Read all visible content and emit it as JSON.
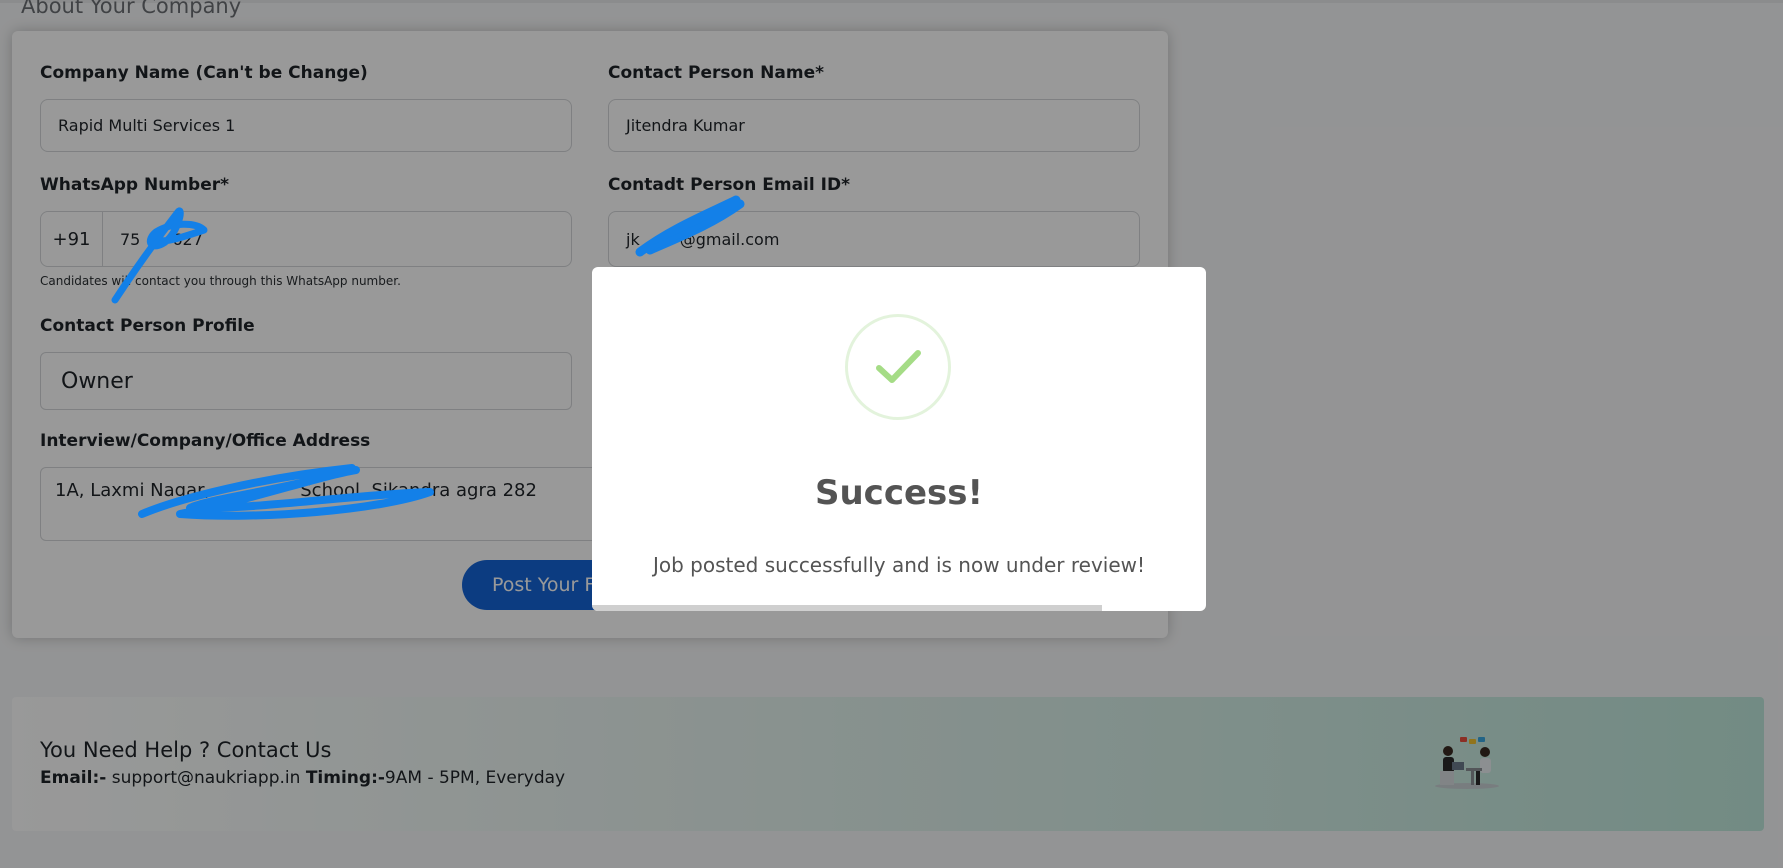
{
  "section": {
    "heading": "About Your Company"
  },
  "form": {
    "company_name": {
      "label": "Company Name (Can't be Change)",
      "value": "Rapid Multi Services 1"
    },
    "contact_person_name": {
      "label": "Contact Person Name*",
      "value": "Jitendra Kumar"
    },
    "whatsapp": {
      "label": "WhatsApp Number*",
      "prefix": "+91",
      "value": "75    627",
      "hint": "Candidates will contact you through this WhatsApp number."
    },
    "contact_email": {
      "label": "Contadt Person Email ID*",
      "value": "jk     @gmail.com"
    },
    "contact_profile": {
      "label": "Contact Person Profile",
      "value": "Owner"
    },
    "address": {
      "label": "Interview/Company/Office Address",
      "value": "1A, Laxmi Nagar,          School, Sikandra agra 282"
    },
    "submit_label": "Post Your F"
  },
  "help": {
    "title": "You Need Help ? Contact Us",
    "email_label": "Email:-",
    "email_value": " support@naukriapp.in ",
    "timing_label": "Timing:-",
    "timing_value": "9AM - 5PM, Everyday"
  },
  "modal": {
    "title": "Success!",
    "message": "Job posted successfully and is now under review!",
    "icon": "check-icon",
    "progress": 0.83
  },
  "colors": {
    "primary": "#1565d8",
    "success_check": "#a5dc86",
    "success_ring": "#e3f3dc",
    "redaction": "#1380e8"
  }
}
